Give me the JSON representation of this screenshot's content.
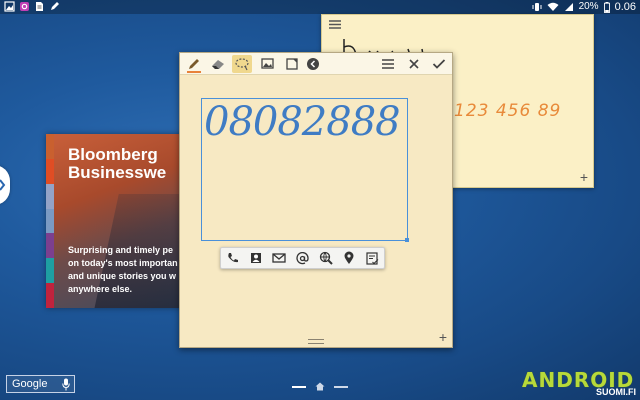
{
  "status_bar": {
    "battery": "20%",
    "clock": "0.06",
    "left_icons": [
      "gallery-icon",
      "messenger-icon",
      "document-icon",
      "pen-icon"
    ],
    "right_icons": [
      "vibrate-icon",
      "wifi-icon",
      "signal-icon",
      "battery-icon"
    ]
  },
  "bloomberg": {
    "title_line1": "Bloomberg",
    "title_line2": "Businesswe",
    "desc_lines": [
      "Surprising and timely pe",
      "on today's most importan",
      "and unique stories you w",
      "anywhere else."
    ],
    "stripe_colors": [
      "#c9602f",
      "#e04d24",
      "#93a3c7",
      "#7a9ac3",
      "#7c3f8f",
      "#1e9fa2",
      "#c0233d"
    ]
  },
  "note_back": {
    "handwriting": "123 456 89",
    "plus": "+",
    "text_color": "#e88a3a"
  },
  "note_front": {
    "handwriting": "08082888",
    "ink_color": "#3f7cc4",
    "plus": "+",
    "toolbar": [
      "pen-icon",
      "eraser-icon",
      "lasso-select-icon",
      "insert-image-icon",
      "expand-note-icon",
      "back-icon",
      "list-icon",
      "close-icon",
      "check-icon"
    ],
    "actions": [
      "phone-icon",
      "contact-icon",
      "message-icon",
      "email-icon",
      "web-search-icon",
      "map-pin-icon",
      "task-icon"
    ]
  },
  "google_search": {
    "label": "Google"
  },
  "watermark": {
    "brand": "ANDROID",
    "sub": "SUOMI.FI"
  }
}
